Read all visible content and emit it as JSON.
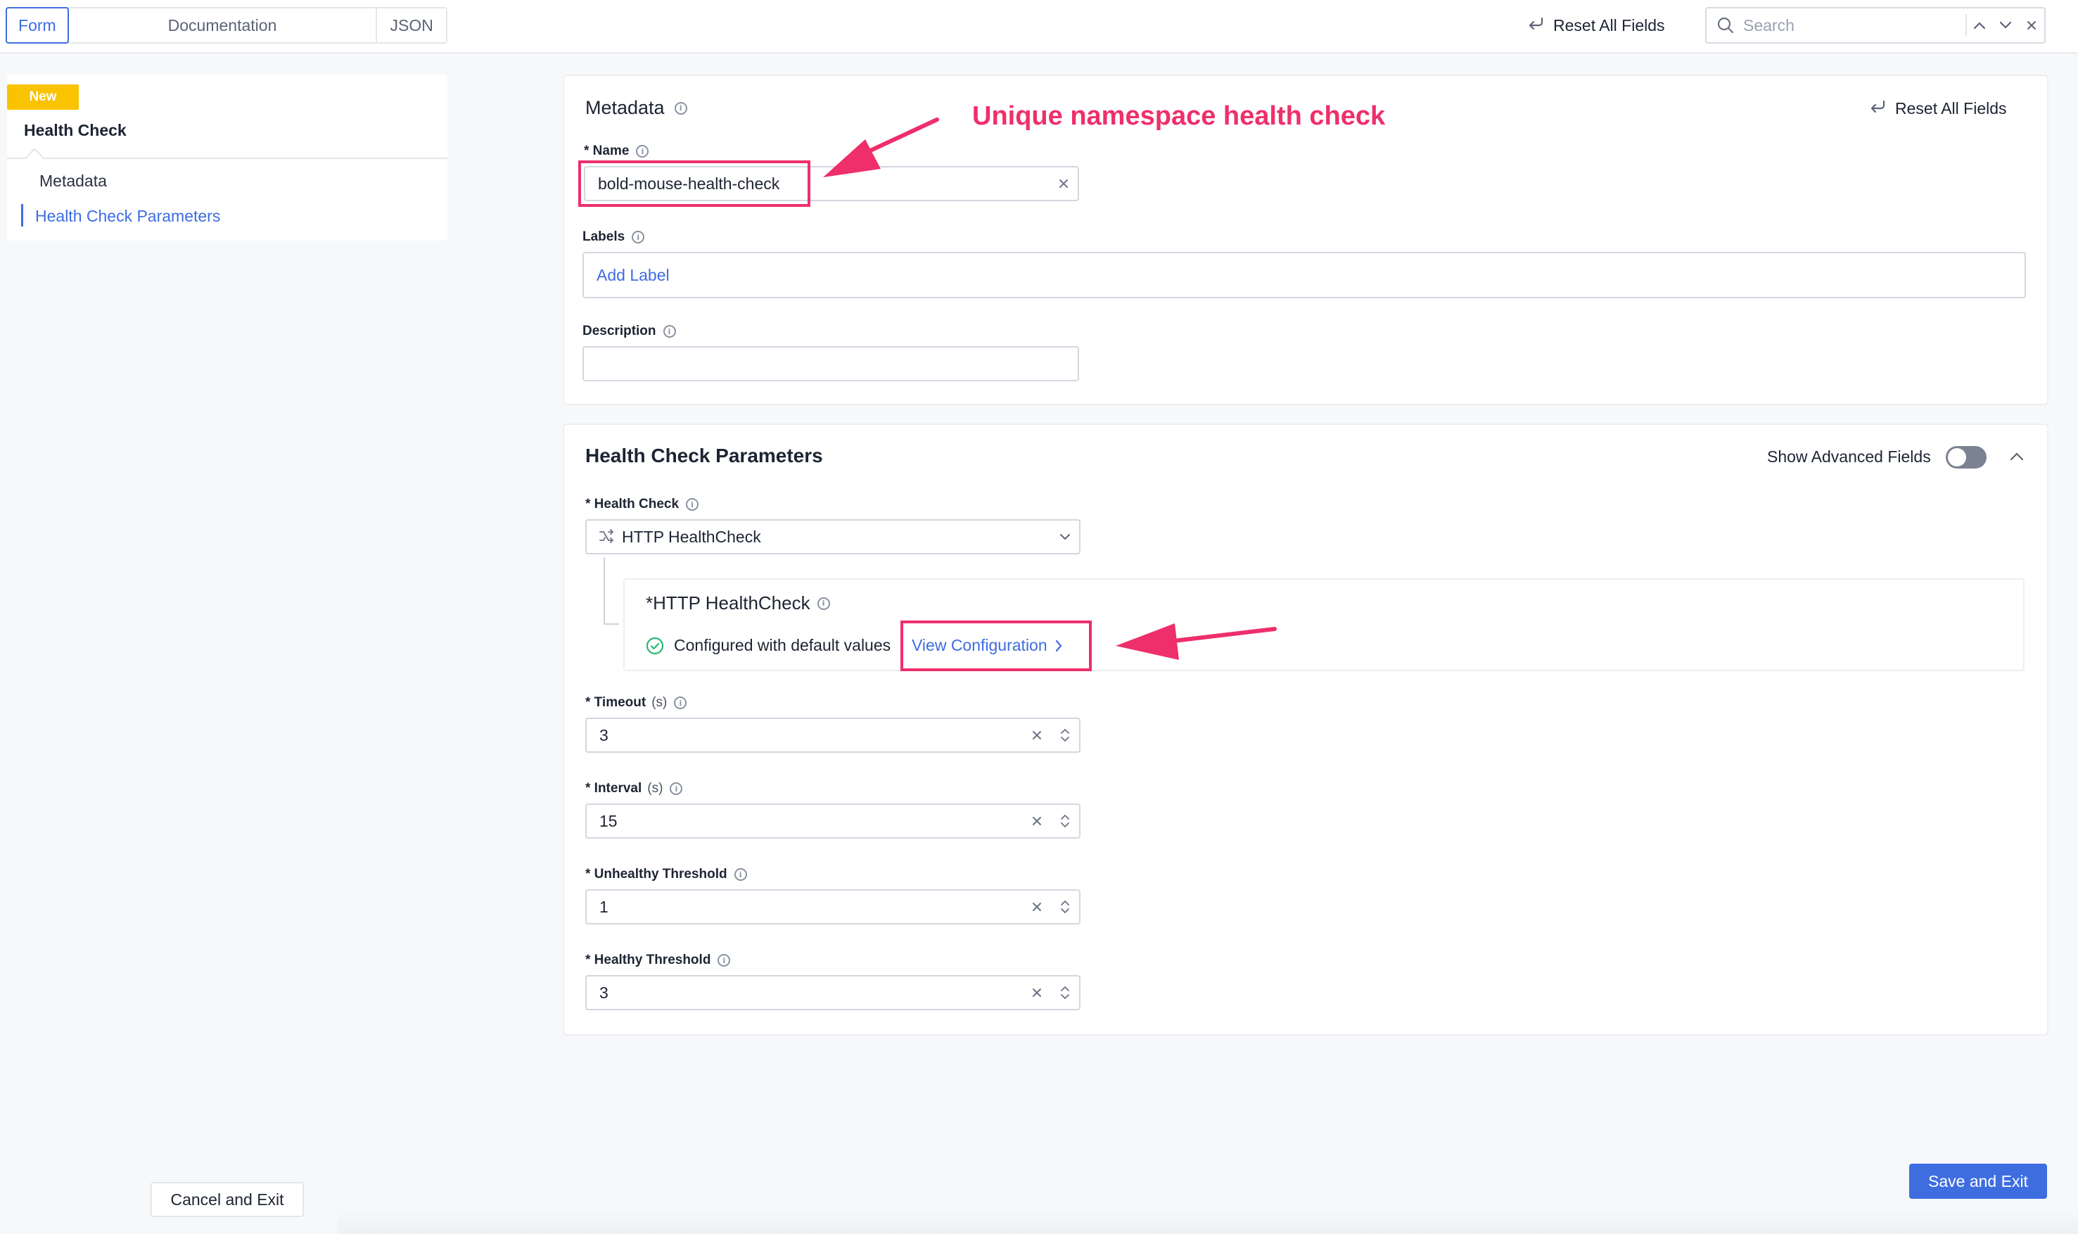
{
  "topbar": {
    "tabs": [
      "Form",
      "Documentation",
      "JSON"
    ],
    "reset_all": "Reset All Fields",
    "search_placeholder": "Search"
  },
  "leftnav": {
    "badge": "New",
    "title": "Health Check",
    "items": [
      "Metadata",
      "Health Check Parameters"
    ]
  },
  "metadata": {
    "title": "Metadata",
    "reset_all": "Reset All Fields",
    "name_label": "* Name",
    "name_value": "bold-mouse-health-check",
    "labels_label": "Labels",
    "add_label": "Add Label",
    "description_label": "Description"
  },
  "params": {
    "title": "Health Check Parameters",
    "show_advanced": "Show Advanced Fields",
    "health_check_label": "* Health Check",
    "health_check_value": "HTTP HealthCheck",
    "sub_title": "*HTTP HealthCheck",
    "configured_text": "Configured with default values",
    "view_config": "View Configuration",
    "timeout_label": "* Timeout",
    "timeout_unit": "(s)",
    "timeout_value": "3",
    "interval_label": "* Interval",
    "interval_unit": "(s)",
    "interval_value": "15",
    "unhealthy_label": "* Unhealthy Threshold",
    "unhealthy_value": "1",
    "healthy_label": "* Healthy Threshold",
    "healthy_value": "3"
  },
  "annotation": {
    "text": "Unique namespace health check",
    "color": "#ee2f6b"
  },
  "footer": {
    "cancel": "Cancel and Exit",
    "save": "Save and Exit"
  },
  "colors": {
    "accent": "#3e6de0",
    "badge": "#f9c300",
    "success": "#2bb673"
  }
}
